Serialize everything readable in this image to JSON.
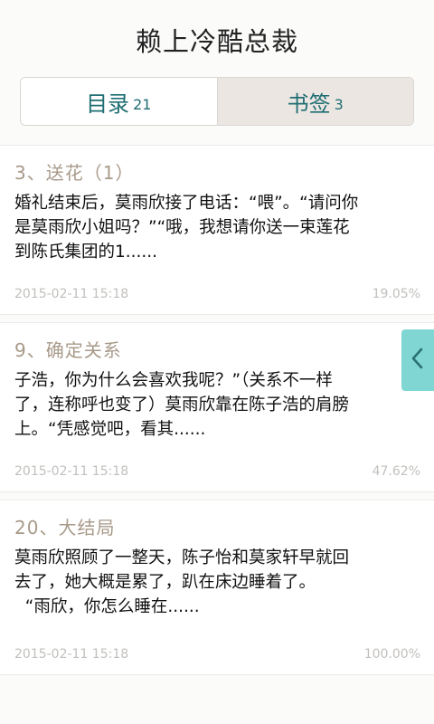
{
  "header": {
    "title": "赖上冷酷总裁"
  },
  "tabs": [
    {
      "label": "目录",
      "count": "21"
    },
    {
      "label": "书签",
      "count": "3"
    }
  ],
  "bookmarks": [
    {
      "title": "3、送花（1）",
      "excerpt": "婚礼结束后，莫雨欣接了电话：“喂”。“请问你\n是莫雨欣小姐吗？”“哦，我想请你送一束莲花\n到陈氏集团的1......",
      "date": "2015-02-11  15:18",
      "progress": "19.05%"
    },
    {
      "title": "9、确定关系",
      "excerpt": "子浩，你为什么会喜欢我呢？”（关系不一样\n了，连称呼也变了）莫雨欣靠在陈子浩的肩膀\n上。“凭感觉吧，看其......",
      "date": "2015-02-11  15:18",
      "progress": "47.62%"
    },
    {
      "title": "20、大结局",
      "excerpt": "莫雨欣照顾了一整天，陈子怡和莫家轩早就回\n去了，她大概是累了，趴在床边睡着了。\n  “雨欣，你怎么睡在......",
      "date": "2015-02-11  15:18",
      "progress": "100.00%"
    }
  ],
  "side_tab": {
    "icon": "chevron-left-icon"
  },
  "colors": {
    "accent": "#1f6e73",
    "title_muted": "#a89a8a",
    "side_tab": "#7fd6d2",
    "active_tab_bg": "#ebe6e2"
  }
}
